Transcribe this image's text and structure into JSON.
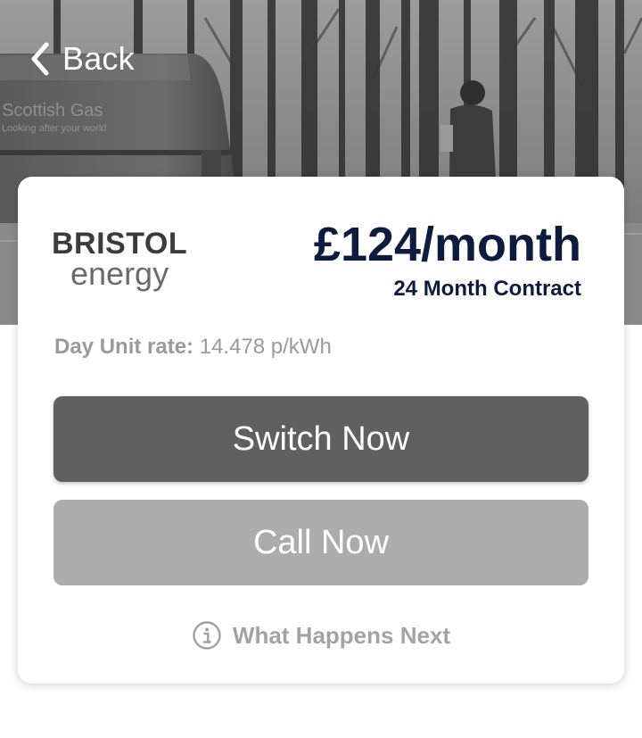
{
  "hero": {
    "van_brand": "Scottish Gas",
    "van_tagline": "Looking after your world"
  },
  "nav": {
    "back_label": "Back"
  },
  "tariff": {
    "supplier_logo_line1": "BRISTOL",
    "supplier_logo_line2": "energy",
    "price": "£124/month",
    "contract": "24 Month Contract",
    "unit_rate_label": "Day Unit rate:",
    "unit_rate_value": "14.478 p/kWh"
  },
  "actions": {
    "switch_label": "Switch Now",
    "call_label": "Call Now",
    "next_label": "What Happens Next"
  },
  "icons": {
    "back": "chevron-left-icon",
    "info": "info-icon"
  },
  "colors": {
    "price_text": "#0d1b3e",
    "switch_button": "#606060",
    "call_button": "#acacac",
    "muted_text": "#9a9a9a"
  }
}
